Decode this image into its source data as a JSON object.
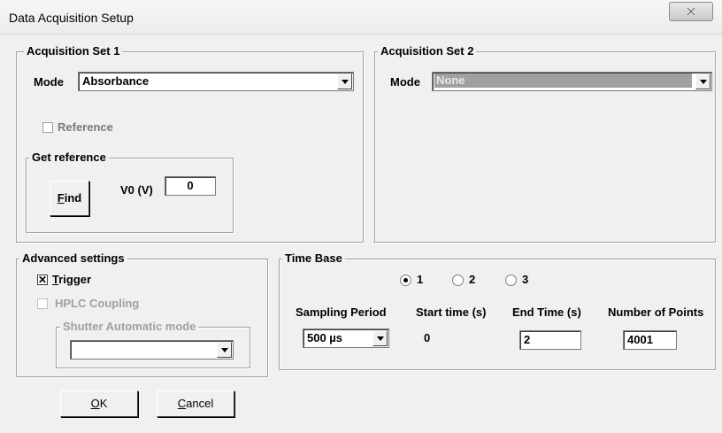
{
  "window": {
    "title": "Data Acquisition Setup"
  },
  "acq1": {
    "title": "Acquisition Set 1",
    "mode_label": "Mode",
    "mode_value": "Absorbance",
    "reference_label": "Reference",
    "get_reference": {
      "title": "Get reference",
      "find_button_first": "F",
      "find_button_rest": "ind",
      "v0_label": "V0 (V)",
      "v0_value": "0"
    }
  },
  "acq2": {
    "title": "Acquisition Set 2",
    "mode_label": "Mode",
    "mode_value": "None"
  },
  "advanced": {
    "title": "Advanced settings",
    "trigger_first": "T",
    "trigger_rest": "rigger",
    "trigger_checked": true,
    "hplc_label": "HPLC Coupling",
    "shutter_title": "Shutter Automatic mode",
    "shutter_value": ""
  },
  "timebase": {
    "title": "Time Base",
    "radios": [
      "1",
      "2",
      "3"
    ],
    "selected_radio": "1",
    "sampling_label": "Sampling Period",
    "sampling_value": "500 µs",
    "start_label": "Start time (s)",
    "start_value": "0",
    "end_label": "End Time (s)",
    "end_value": "2",
    "points_label": "Number of Points",
    "points_value": "4001"
  },
  "buttons": {
    "ok_first": "O",
    "ok_rest": "K",
    "cancel_first": "C",
    "cancel_rest": "ancel"
  }
}
